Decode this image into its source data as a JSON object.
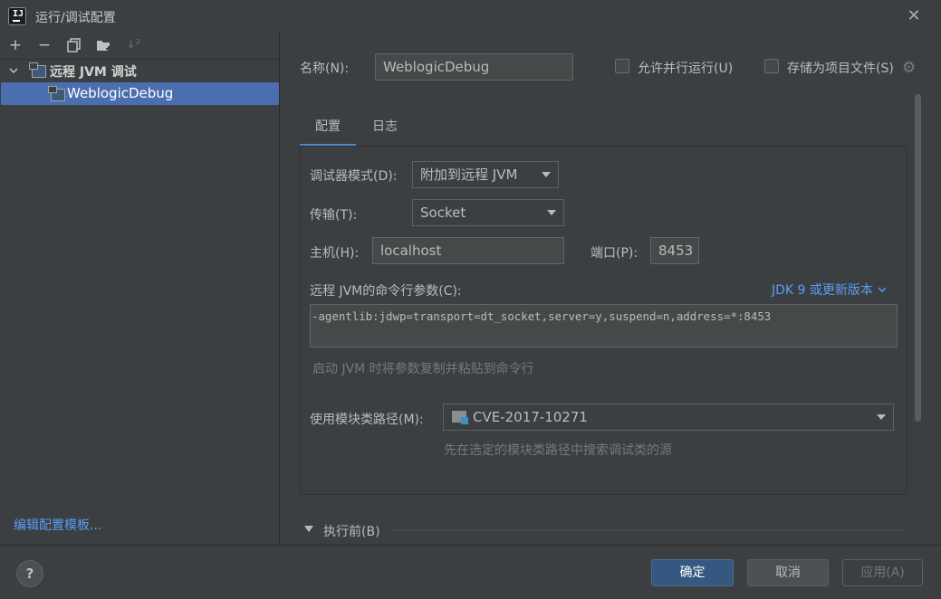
{
  "window": {
    "title": "运行/调试配置"
  },
  "toolbar": {
    "icons": [
      "add-icon",
      "remove-icon",
      "copy-icon",
      "folder-add-icon",
      "sort-icon"
    ]
  },
  "tree": {
    "group_label": "远程 JVM 调试",
    "item_label": "WeblogicDebug"
  },
  "left_footer": {
    "edit_templates": "编辑配置模板..."
  },
  "form": {
    "name_label": "名称(N):",
    "name_value": "WeblogicDebug",
    "allow_parallel_label": "允许并行运行(U)",
    "store_as_file_label": "存储为项目文件(S)",
    "tabs": [
      {
        "label": "配置",
        "active": true
      },
      {
        "label": "日志",
        "active": false
      }
    ],
    "debugger_mode_label": "调试器模式(D):",
    "debugger_mode_value": "附加到远程 JVM",
    "transport_label": "传输(T):",
    "transport_value": "Socket",
    "host_label": "主机(H):",
    "host_value": "localhost",
    "port_label": "端口(P):",
    "port_value": "8453",
    "args_label": "远程 JVM的命令行参数(C):",
    "jdk_link": "JDK 9 或更新版本",
    "args_value": "-agentlib:jdwp=transport=dt_socket,server=y,suspend=n,address=*:8453",
    "args_hint": "启动 JVM 时将参数复制并粘贴到命令行",
    "module_label": "使用模块类路径(M):",
    "module_value": "CVE-2017-10271",
    "module_hint": "先在选定的模块类路径中搜索调试类的源",
    "before_launch_label": "执行前(B)"
  },
  "buttons": {
    "help": "?",
    "ok": "确定",
    "cancel": "取消",
    "apply": "应用(A)"
  },
  "colors": {
    "background": "#3c3f41",
    "selection": "#4b6eaf",
    "link": "#589df6",
    "primary_button": "#365880",
    "tab_underline": "#4a88c7"
  }
}
